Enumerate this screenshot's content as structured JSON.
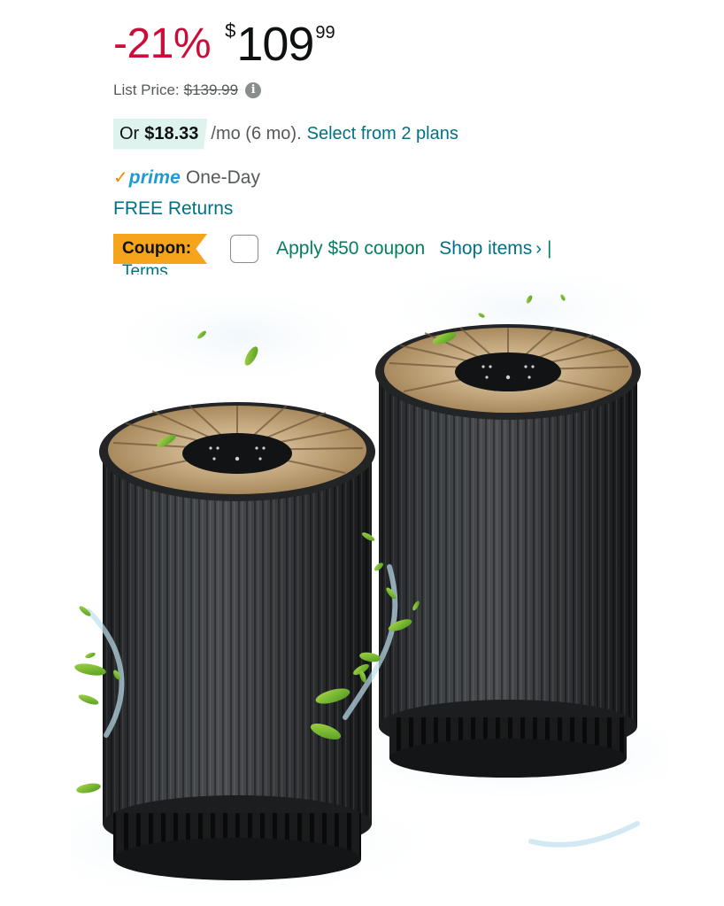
{
  "price": {
    "discount": "-21%",
    "currency_symbol": "$",
    "whole": "109",
    "fraction": "99"
  },
  "list_price": {
    "label": "List Price:",
    "value": "$139.99"
  },
  "monthly": {
    "prefix": "Or",
    "amount": "$18.33",
    "term": "/mo (6 mo).",
    "plans_link": "Select from 2 plans"
  },
  "delivery": {
    "prime_label": "prime",
    "one_day": "One-Day",
    "free_returns": "FREE Returns"
  },
  "coupon": {
    "tag": "Coupon:",
    "apply_label": "Apply $50 coupon",
    "shop_items": "Shop items",
    "chevron": "›",
    "separator": "|",
    "terms": "Terms"
  },
  "icons": {
    "info": "info-icon",
    "prime_check": "checkmark-icon"
  },
  "colors": {
    "discount": "#cc0c39",
    "link": "#007185",
    "coupon_green": "#067d62",
    "coupon_tag": "#f7a41d",
    "prime_blue": "#1f9ad6",
    "prime_check": "#f08804",
    "monthly_badge_bg": "#dff3ee"
  }
}
